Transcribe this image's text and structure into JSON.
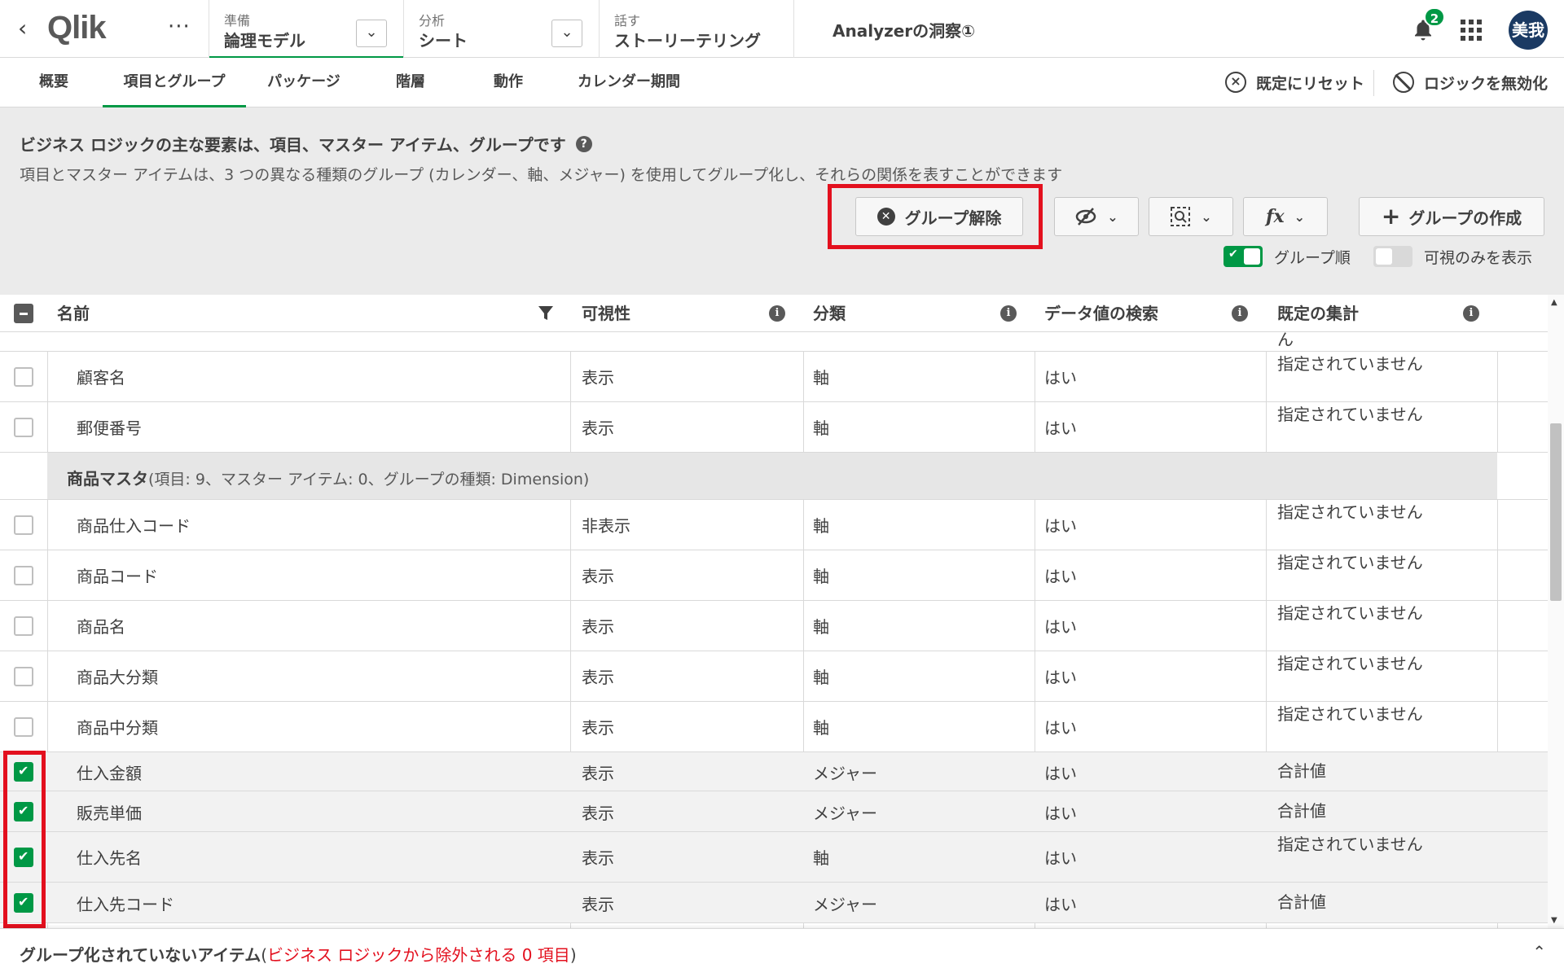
{
  "topbar": {
    "logo": "Qlik",
    "more": "···",
    "nav": [
      {
        "small": "準備",
        "big": "論理モデル"
      },
      {
        "small": "分析",
        "big": "シート"
      },
      {
        "small": "話す",
        "big": "ストーリーテリング"
      }
    ],
    "app_title": "Analyzerの洞察①",
    "notification_count": "2",
    "avatar_initials": "美我"
  },
  "subnav": {
    "tabs": [
      "概要",
      "項目とグループ",
      "パッケージ",
      "階層",
      "動作",
      "カレンダー期間"
    ],
    "active_tab": "項目とグループ",
    "reset_label": "既定にリセット",
    "disable_label": "ロジックを無効化"
  },
  "description": {
    "title": "ビジネス ロジックの主な要素は、項目、マスター アイテム、グループです",
    "subtitle": "項目とマスター アイテムは、3 つの異なる種類のグループ (カレンダー、軸、メジャー) を使用してグループ化し、それらの関係を表すことができます"
  },
  "toolbar": {
    "ungroup_label": "グループ解除",
    "create_group_label": "グループの作成",
    "group_order_label": "グループ順",
    "visible_only_label": "可視のみを表示",
    "group_order_on": true,
    "visible_only_on": false
  },
  "table": {
    "headers": {
      "name": "名前",
      "visibility": "可視性",
      "classification": "分類",
      "search": "データ値の検索",
      "aggregation": "既定の集計"
    },
    "top_partial_agg": "ん",
    "rows_before_group": [
      {
        "name": "顧客名",
        "visibility": "表示",
        "classification": "軸",
        "search": "はい",
        "aggregation": "指定されていません",
        "checked": false
      },
      {
        "name": "郵便番号",
        "visibility": "表示",
        "classification": "軸",
        "search": "はい",
        "aggregation": "指定されていません",
        "checked": false
      }
    ],
    "group": {
      "name": "商品マスタ",
      "detail": "(項目: 9、マスター アイテム: 0、グループの種類: Dimension)"
    },
    "rows_after_group": [
      {
        "name": "商品仕入コード",
        "visibility": "非表示",
        "classification": "軸",
        "search": "はい",
        "aggregation": "指定されていません",
        "checked": false
      },
      {
        "name": "商品コード",
        "visibility": "表示",
        "classification": "軸",
        "search": "はい",
        "aggregation": "指定されていません",
        "checked": false
      },
      {
        "name": "商品名",
        "visibility": "表示",
        "classification": "軸",
        "search": "はい",
        "aggregation": "指定されていません",
        "checked": false
      },
      {
        "name": "商品大分類",
        "visibility": "表示",
        "classification": "軸",
        "search": "はい",
        "aggregation": "指定されていません",
        "checked": false
      },
      {
        "name": "商品中分類",
        "visibility": "表示",
        "classification": "軸",
        "search": "はい",
        "aggregation": "指定されていません",
        "checked": false
      },
      {
        "name": "仕入金額",
        "visibility": "表示",
        "classification": "メジャー",
        "search": "はい",
        "aggregation": "合計値",
        "checked": true
      },
      {
        "name": "販売単価",
        "visibility": "表示",
        "classification": "メジャー",
        "search": "はい",
        "aggregation": "合計値",
        "checked": true
      },
      {
        "name": "仕入先名",
        "visibility": "表示",
        "classification": "軸",
        "search": "はい",
        "aggregation": "指定されていません",
        "checked": true
      },
      {
        "name": "仕入先コード",
        "visibility": "表示",
        "classification": "メジャー",
        "search": "はい",
        "aggregation": "合計値",
        "checked": true
      }
    ]
  },
  "footer": {
    "title": "グループ化されていないアイテム",
    "detail_open": "(",
    "detail": "ビジネス ロジックから除外される 0 項目",
    "detail_close": ")"
  },
  "colors": {
    "accent": "#009845",
    "highlight": "#e3101e",
    "avatar_bg": "#1b3a63"
  },
  "icons": [
    "back-arrow-icon",
    "more-icon",
    "chevron-down-icon",
    "bell-icon",
    "apps-grid-icon",
    "reset-icon",
    "ban-icon",
    "help-icon",
    "close-circle-icon",
    "hide-icon",
    "search-icon",
    "fx-icon",
    "plus-icon",
    "filter-icon",
    "info-icon",
    "chevron-up-icon"
  ]
}
